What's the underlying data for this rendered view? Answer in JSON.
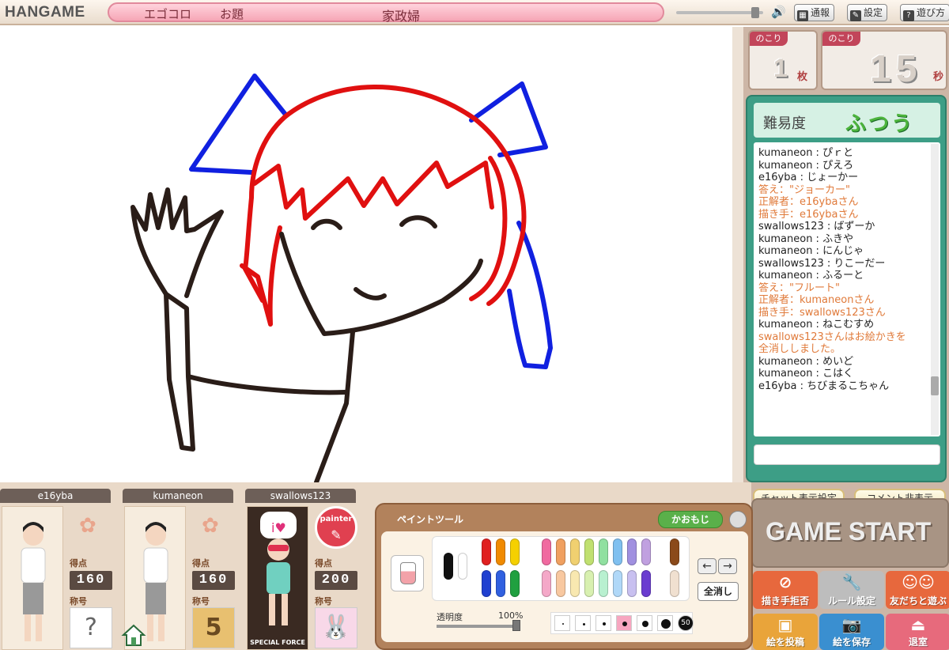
{
  "app": {
    "logo": "HANGAME"
  },
  "topbar": {
    "game_title": "エゴコロ",
    "topic_label": "お題",
    "topic_value": "家政婦",
    "buttons": [
      {
        "label": "通報",
        "icon": "report-icon"
      },
      {
        "label": "設定",
        "icon": "settings-icon"
      },
      {
        "label": "遊び方",
        "icon": "help-icon"
      }
    ]
  },
  "counters": {
    "sheets": {
      "caption": "のこり",
      "value": "1",
      "unit": "枚"
    },
    "seconds": {
      "caption": "のこり",
      "value": "15",
      "unit": "秒"
    }
  },
  "difficulty": {
    "label": "難易度",
    "value": "ふつう"
  },
  "chat": {
    "lines": [
      {
        "text": "kumaneon : ぴｒと",
        "sys": false
      },
      {
        "text": "kumaneon : ぴえろ",
        "sys": false
      },
      {
        "text": "e16yba : じょーかー",
        "sys": false
      },
      {
        "text": "答え：\"ジョーカー\"",
        "sys": true
      },
      {
        "text": "正解者：e16ybaさん",
        "sys": true
      },
      {
        "text": "描き手：e16ybaさん",
        "sys": true
      },
      {
        "text": "swallows123 : ばずーか",
        "sys": false
      },
      {
        "text": "kumaneon : ふきや",
        "sys": false
      },
      {
        "text": "kumaneon : にんじゃ",
        "sys": false
      },
      {
        "text": "swallows123 : りこーだー",
        "sys": false
      },
      {
        "text": "kumaneon : ふるーと",
        "sys": false
      },
      {
        "text": "答え：\"フルート\"",
        "sys": true
      },
      {
        "text": "正解者：kumaneonさん",
        "sys": true
      },
      {
        "text": "描き手：swallows123さん",
        "sys": true
      },
      {
        "text": "kumaneon : ねこむすめ",
        "sys": false
      },
      {
        "text": "swallows123さんはお絵かきを",
        "sys": true
      },
      {
        "text": "全消ししました。",
        "sys": true
      },
      {
        "text": "kumaneon : めいど",
        "sys": false
      },
      {
        "text": "kumaneon : こはく",
        "sys": false
      },
      {
        "text": "e16yba : ちびまるこちゃん",
        "sys": false
      }
    ],
    "settings_button": "チャット表示設定",
    "hide_comments_button": "コメント非表示"
  },
  "game_start": {
    "label": "GAME START"
  },
  "actions": [
    {
      "label": "描き手拒否",
      "icon": "no-draw-icon",
      "color": "#e7683d"
    },
    {
      "label": "ルール設定",
      "icon": "wrench-icon",
      "color": "#bdbdbd"
    },
    {
      "label": "友だちと遊ぶ",
      "icon": "friends-icon",
      "color": "#e7683d"
    },
    {
      "label": "絵を投稿",
      "icon": "picture-icon",
      "color": "#e9a43a"
    },
    {
      "label": "絵を保存",
      "icon": "camera-icon",
      "color": "#3a8fd0"
    },
    {
      "label": "退室",
      "icon": "exit-icon",
      "color": "#e76a7c"
    }
  ],
  "players": [
    {
      "name": "e16yba",
      "score_label": "得点",
      "score": "160",
      "title_label": "称号",
      "title_badge": "?"
    },
    {
      "name": "kumaneon",
      "score_label": "得点",
      "score": "160",
      "title_label": "称号",
      "title_badge": "5"
    },
    {
      "name": "swallows123",
      "score_label": "得点",
      "score": "200",
      "title_label": "称号",
      "title_badge": "🐰",
      "painter_badge": "painter",
      "avatar_caption": "SPECIAL FORCE"
    }
  ],
  "paint_tool": {
    "title": "ペイントツール",
    "kaomoji_button": "かおもじ",
    "clear_all_button": "全消し",
    "opacity_label": "透明度",
    "opacity_value": "100%",
    "opacity_level": 1.0,
    "brush_size_max_label": "50",
    "colors": {
      "mono": [
        "#111111",
        "#ffffff"
      ],
      "row1": [
        "#e02020",
        "#f08a00",
        "#f5d000",
        "#f06aa0",
        "#f0a060",
        "#f0d070",
        "#c0e070",
        "#90e0a0",
        "#80c0f0",
        "#a090e0",
        "#c0a0e0",
        "#8b4a1a",
        "#b07030",
        "#c09050"
      ],
      "row2": [
        "#2040d0",
        "#3060e0",
        "#20a040",
        "#f4a8c8",
        "#f8c8a0",
        "#f8e8b0",
        "#d8f0b0",
        "#b8f0d0",
        "#b0d8f8",
        "#c8c0f0",
        "#6a3cd0",
        "#f0e0d0",
        "#f8f0e0",
        "#f8f8f0"
      ]
    }
  }
}
